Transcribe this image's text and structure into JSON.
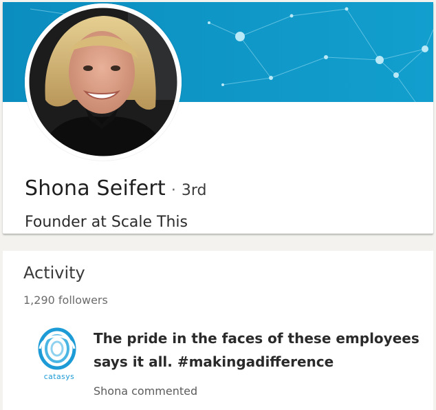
{
  "profile": {
    "name": "Shona Seifert",
    "degree_separator": "·",
    "degree": "3rd",
    "headline": "Founder at Scale This"
  },
  "activity": {
    "title": "Activity",
    "followers": "1,290 followers",
    "post": {
      "logo_text": "catasys",
      "text_line1": "The pride in the faces of these employees",
      "text_line2": "says it all. #makingadifference",
      "meta": "Shona commented"
    }
  },
  "colors": {
    "banner": "#0e97c6",
    "logo_blue": "#1d9bd6",
    "page_bg": "#f3f2ef"
  }
}
